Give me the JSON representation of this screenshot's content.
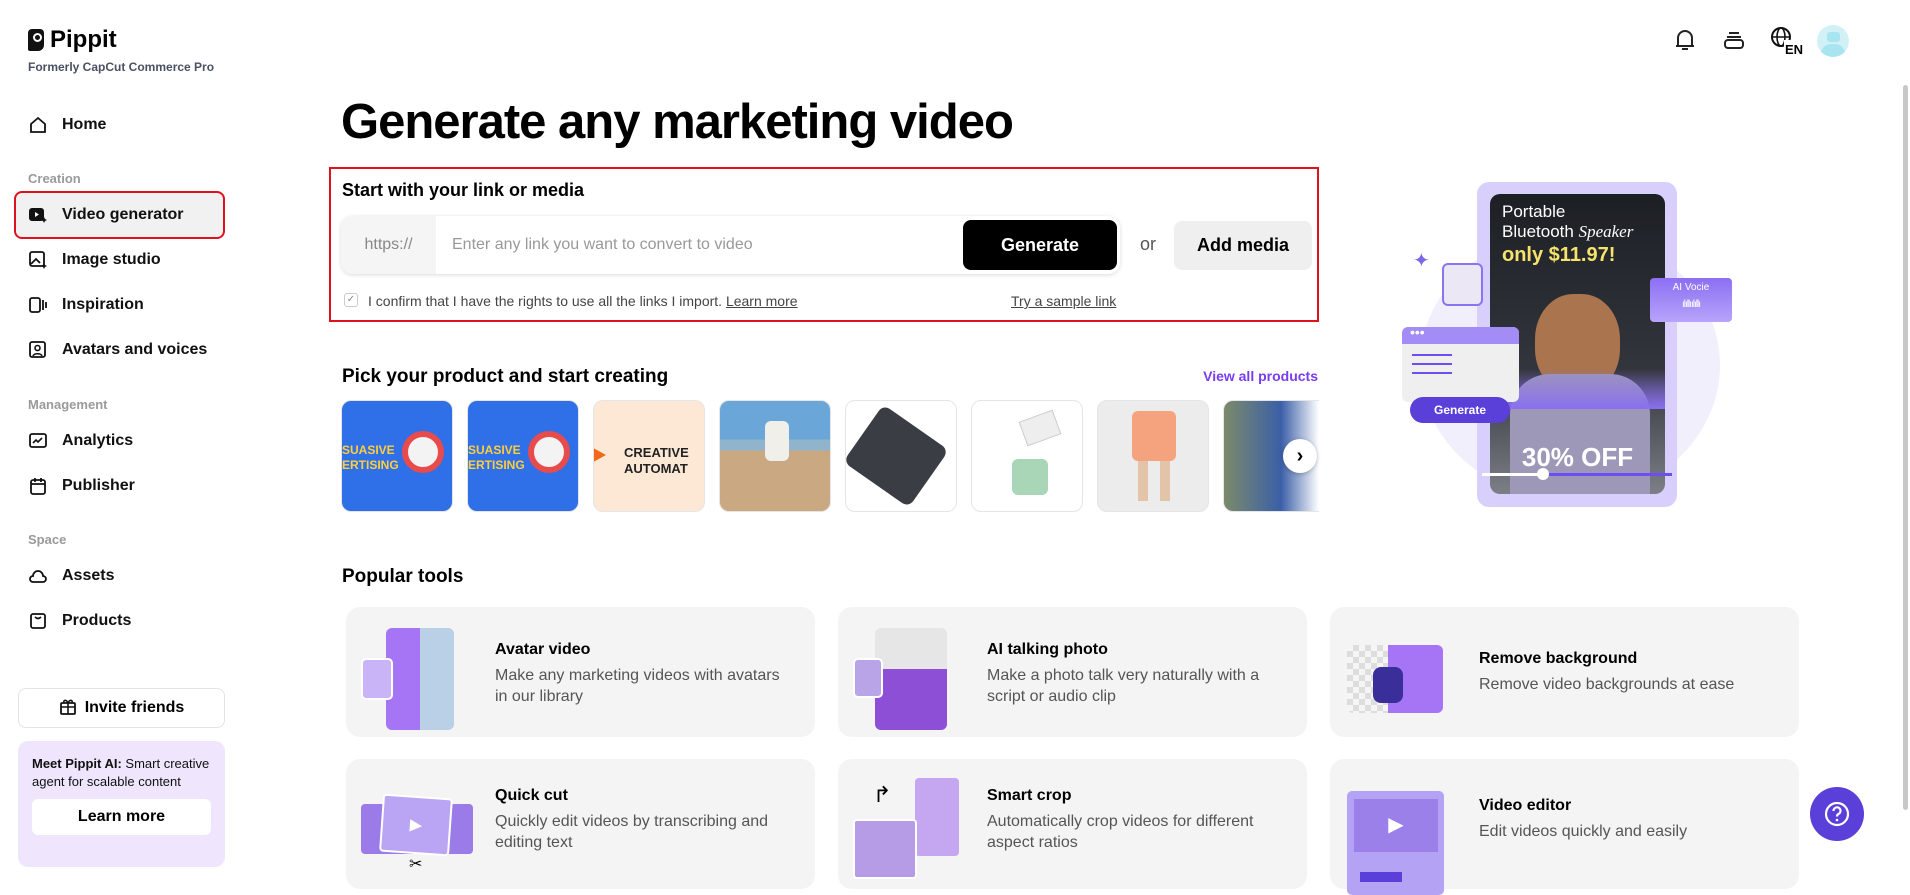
{
  "brand": {
    "name": "Pippit",
    "subtitle": "Formerly CapCut Commerce Pro"
  },
  "sidebar": {
    "home": "Home",
    "groups": {
      "creation": "Creation",
      "management": "Management",
      "space": "Space"
    },
    "items": {
      "video_generator": "Video generator",
      "image_studio": "Image studio",
      "inspiration": "Inspiration",
      "avatars": "Avatars and voices",
      "analytics": "Analytics",
      "publisher": "Publisher",
      "assets": "Assets",
      "products": "Products"
    },
    "invite": "Invite friends",
    "promo": {
      "bold": "Meet Pippit AI:",
      "text": " Smart creative agent for scalable content",
      "button": "Learn more"
    }
  },
  "header": {
    "language": "EN"
  },
  "main": {
    "title": "Generate any marketing video",
    "link_section": {
      "label": "Start with your link or media",
      "prefix": "https://",
      "placeholder": "Enter any link you want to convert to video",
      "generate": "Generate",
      "or": "or",
      "add_media": "Add media",
      "confirm": "I confirm that I have the rights to use all the links I import.",
      "learn_more": "Learn more",
      "sample": "Try a sample link",
      "checked": true
    },
    "products": {
      "title": "Pick your product and start creating",
      "view_all": "View all products",
      "thumb_texts": [
        "SUASIVE ERTISING",
        "SUASIVE ERTISING",
        "CREATIVE AUTOMAT"
      ]
    },
    "promo_art": {
      "line1": "Portable",
      "line2": "Bluetooth",
      "line2b": "Speaker",
      "price": "only $11.97!",
      "discount": "30% OFF",
      "voice": "AI Vocie",
      "generate": "Generate"
    },
    "tools": {
      "title": "Popular tools",
      "items": [
        {
          "title": "Avatar video",
          "desc": "Make any marketing videos with avatars in our library"
        },
        {
          "title": "AI talking photo",
          "desc": "Make a photo talk very naturally with a script or audio clip"
        },
        {
          "title": "Remove background",
          "desc": "Remove video backgrounds at ease"
        },
        {
          "title": "Quick cut",
          "desc": "Quickly edit videos by transcribing and editing text"
        },
        {
          "title": "Smart crop",
          "desc": "Automatically crop videos for different aspect ratios"
        },
        {
          "title": "Video editor",
          "desc": "Edit videos quickly and easily"
        }
      ]
    }
  },
  "colors": {
    "accent": "#7a3cf0",
    "highlight": "#e0101c",
    "help": "#5b3fd9"
  }
}
